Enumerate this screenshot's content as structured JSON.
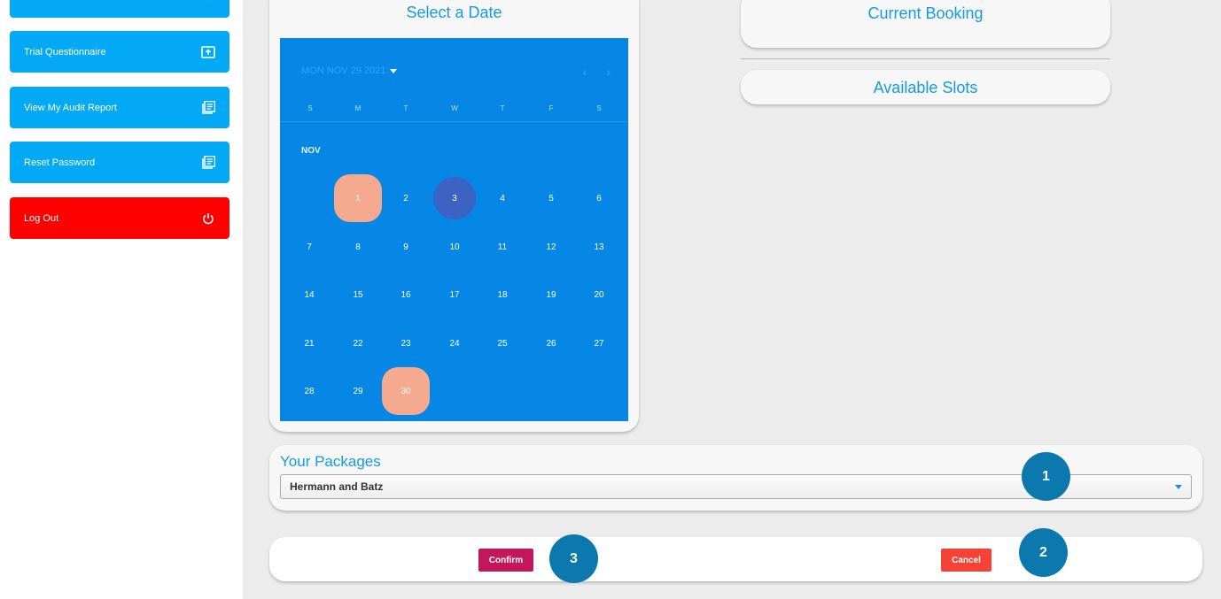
{
  "sidebar": {
    "items": [
      {
        "label": "",
        "icon": "chevron-down-icon"
      },
      {
        "label": "Trial Questionnaire",
        "icon": "upload-box-icon"
      },
      {
        "label": "View My Audit Report",
        "icon": "report-icon"
      },
      {
        "label": "Reset Password",
        "icon": "report-icon"
      },
      {
        "label": "Log Out",
        "icon": "power-icon"
      }
    ]
  },
  "date_card": {
    "title": "Select a Date",
    "calendar": {
      "header": "MON NOV 29 2021",
      "weekdays": [
        "S",
        "M",
        "T",
        "W",
        "T",
        "F",
        "S"
      ],
      "month_label": "NOV",
      "days": [
        "1",
        "2",
        "3",
        "4",
        "5",
        "6",
        "7",
        "8",
        "9",
        "10",
        "11",
        "12",
        "13",
        "14",
        "15",
        "16",
        "17",
        "18",
        "19",
        "20",
        "21",
        "22",
        "23",
        "24",
        "25",
        "26",
        "27",
        "28",
        "29",
        "30"
      ],
      "highlighted_days": [
        "1",
        "30"
      ],
      "selected_day": "3"
    }
  },
  "booking": {
    "current_title": "Current Booking",
    "slots_title": "Available Slots"
  },
  "packages": {
    "title": "Your Packages",
    "selected": "Hermann and Batz"
  },
  "actions": {
    "confirm": "Confirm",
    "cancel": "Cancel"
  },
  "markers": [
    "1",
    "2",
    "3"
  ],
  "colors": {
    "accent": "#03a9f4",
    "calendar_bg": "#0687e6",
    "highlight": "#f5a98f",
    "selected": "#3c62c4",
    "logout": "#ff0000",
    "confirm": "#c2185b",
    "cancel": "#f44336",
    "marker": "#0b79ae"
  }
}
